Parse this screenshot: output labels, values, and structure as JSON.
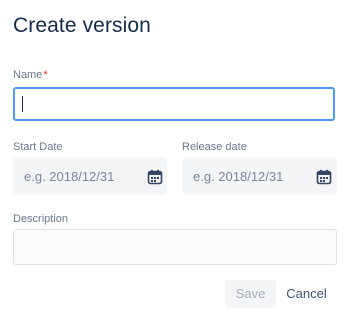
{
  "dialog": {
    "title": "Create version",
    "name_field": {
      "label": "Name",
      "required_marker": "*",
      "value": ""
    },
    "start_date": {
      "label": "Start Date",
      "placeholder": "e.g. 2018/12/31",
      "icon": "calendar-icon"
    },
    "release_date": {
      "label": "Release date",
      "placeholder": "e.g. 2018/12/31",
      "icon": "calendar-icon"
    },
    "description": {
      "label": "Description",
      "value": ""
    },
    "buttons": {
      "save_label": "Save",
      "cancel_label": "Cancel"
    }
  },
  "colors": {
    "focus_border": "#4c9aff",
    "required": "#de350b",
    "title_text": "#172b4d",
    "label_text": "#6b778c"
  }
}
